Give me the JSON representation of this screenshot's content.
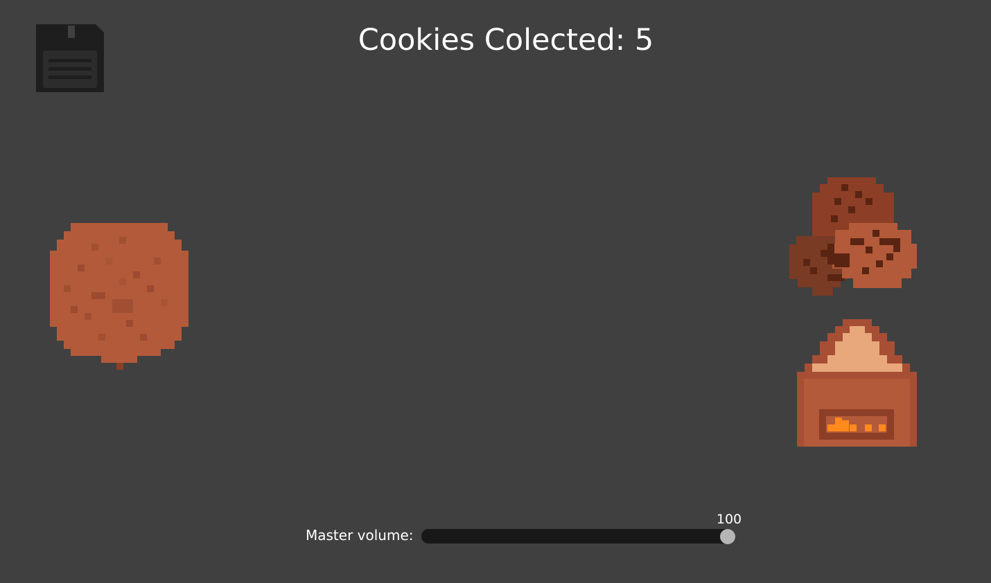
{
  "hud": {
    "cookies_label": "Cookies Colected: 5",
    "cookies_count": 5
  },
  "save": {
    "icon": "floppy-disk-icon"
  },
  "clicker": {
    "cookie_icon": "cookie-icon"
  },
  "shop": {
    "cookies_icon": "cookie-stack-icon",
    "oven_icon": "oven-icon"
  },
  "volume": {
    "label": "Master volume:",
    "value": "100",
    "level_fraction": 1.0
  },
  "colors": {
    "background": "#404040",
    "cookie": "#b35a3a",
    "cookie_dark": "#8c3f26",
    "chocolate": "#5a2412",
    "oven_body": "#a64f35",
    "oven_top": "#e8a87c",
    "fire": "#ff8a1c",
    "slider_track": "#181818",
    "slider_thumb": "#b5b5b5"
  }
}
